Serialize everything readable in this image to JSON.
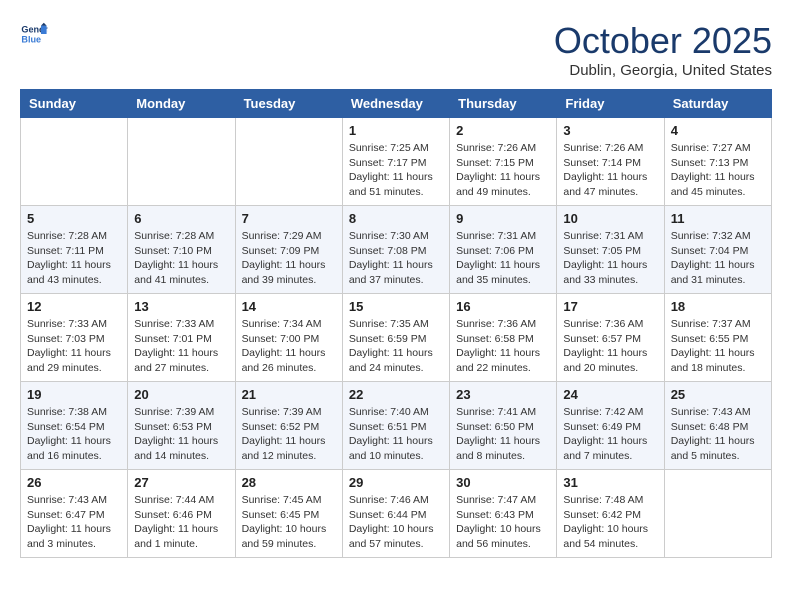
{
  "header": {
    "logo_line1": "General",
    "logo_line2": "Blue",
    "month": "October 2025",
    "location": "Dublin, Georgia, United States"
  },
  "days_of_week": [
    "Sunday",
    "Monday",
    "Tuesday",
    "Wednesday",
    "Thursday",
    "Friday",
    "Saturday"
  ],
  "weeks": [
    [
      {
        "day": "",
        "info": ""
      },
      {
        "day": "",
        "info": ""
      },
      {
        "day": "",
        "info": ""
      },
      {
        "day": "1",
        "info": "Sunrise: 7:25 AM\nSunset: 7:17 PM\nDaylight: 11 hours\nand 51 minutes."
      },
      {
        "day": "2",
        "info": "Sunrise: 7:26 AM\nSunset: 7:15 PM\nDaylight: 11 hours\nand 49 minutes."
      },
      {
        "day": "3",
        "info": "Sunrise: 7:26 AM\nSunset: 7:14 PM\nDaylight: 11 hours\nand 47 minutes."
      },
      {
        "day": "4",
        "info": "Sunrise: 7:27 AM\nSunset: 7:13 PM\nDaylight: 11 hours\nand 45 minutes."
      }
    ],
    [
      {
        "day": "5",
        "info": "Sunrise: 7:28 AM\nSunset: 7:11 PM\nDaylight: 11 hours\nand 43 minutes."
      },
      {
        "day": "6",
        "info": "Sunrise: 7:28 AM\nSunset: 7:10 PM\nDaylight: 11 hours\nand 41 minutes."
      },
      {
        "day": "7",
        "info": "Sunrise: 7:29 AM\nSunset: 7:09 PM\nDaylight: 11 hours\nand 39 minutes."
      },
      {
        "day": "8",
        "info": "Sunrise: 7:30 AM\nSunset: 7:08 PM\nDaylight: 11 hours\nand 37 minutes."
      },
      {
        "day": "9",
        "info": "Sunrise: 7:31 AM\nSunset: 7:06 PM\nDaylight: 11 hours\nand 35 minutes."
      },
      {
        "day": "10",
        "info": "Sunrise: 7:31 AM\nSunset: 7:05 PM\nDaylight: 11 hours\nand 33 minutes."
      },
      {
        "day": "11",
        "info": "Sunrise: 7:32 AM\nSunset: 7:04 PM\nDaylight: 11 hours\nand 31 minutes."
      }
    ],
    [
      {
        "day": "12",
        "info": "Sunrise: 7:33 AM\nSunset: 7:03 PM\nDaylight: 11 hours\nand 29 minutes."
      },
      {
        "day": "13",
        "info": "Sunrise: 7:33 AM\nSunset: 7:01 PM\nDaylight: 11 hours\nand 27 minutes."
      },
      {
        "day": "14",
        "info": "Sunrise: 7:34 AM\nSunset: 7:00 PM\nDaylight: 11 hours\nand 26 minutes."
      },
      {
        "day": "15",
        "info": "Sunrise: 7:35 AM\nSunset: 6:59 PM\nDaylight: 11 hours\nand 24 minutes."
      },
      {
        "day": "16",
        "info": "Sunrise: 7:36 AM\nSunset: 6:58 PM\nDaylight: 11 hours\nand 22 minutes."
      },
      {
        "day": "17",
        "info": "Sunrise: 7:36 AM\nSunset: 6:57 PM\nDaylight: 11 hours\nand 20 minutes."
      },
      {
        "day": "18",
        "info": "Sunrise: 7:37 AM\nSunset: 6:55 PM\nDaylight: 11 hours\nand 18 minutes."
      }
    ],
    [
      {
        "day": "19",
        "info": "Sunrise: 7:38 AM\nSunset: 6:54 PM\nDaylight: 11 hours\nand 16 minutes."
      },
      {
        "day": "20",
        "info": "Sunrise: 7:39 AM\nSunset: 6:53 PM\nDaylight: 11 hours\nand 14 minutes."
      },
      {
        "day": "21",
        "info": "Sunrise: 7:39 AM\nSunset: 6:52 PM\nDaylight: 11 hours\nand 12 minutes."
      },
      {
        "day": "22",
        "info": "Sunrise: 7:40 AM\nSunset: 6:51 PM\nDaylight: 11 hours\nand 10 minutes."
      },
      {
        "day": "23",
        "info": "Sunrise: 7:41 AM\nSunset: 6:50 PM\nDaylight: 11 hours\nand 8 minutes."
      },
      {
        "day": "24",
        "info": "Sunrise: 7:42 AM\nSunset: 6:49 PM\nDaylight: 11 hours\nand 7 minutes."
      },
      {
        "day": "25",
        "info": "Sunrise: 7:43 AM\nSunset: 6:48 PM\nDaylight: 11 hours\nand 5 minutes."
      }
    ],
    [
      {
        "day": "26",
        "info": "Sunrise: 7:43 AM\nSunset: 6:47 PM\nDaylight: 11 hours\nand 3 minutes."
      },
      {
        "day": "27",
        "info": "Sunrise: 7:44 AM\nSunset: 6:46 PM\nDaylight: 11 hours\nand 1 minute."
      },
      {
        "day": "28",
        "info": "Sunrise: 7:45 AM\nSunset: 6:45 PM\nDaylight: 10 hours\nand 59 minutes."
      },
      {
        "day": "29",
        "info": "Sunrise: 7:46 AM\nSunset: 6:44 PM\nDaylight: 10 hours\nand 57 minutes."
      },
      {
        "day": "30",
        "info": "Sunrise: 7:47 AM\nSunset: 6:43 PM\nDaylight: 10 hours\nand 56 minutes."
      },
      {
        "day": "31",
        "info": "Sunrise: 7:48 AM\nSunset: 6:42 PM\nDaylight: 10 hours\nand 54 minutes."
      },
      {
        "day": "",
        "info": ""
      }
    ]
  ]
}
